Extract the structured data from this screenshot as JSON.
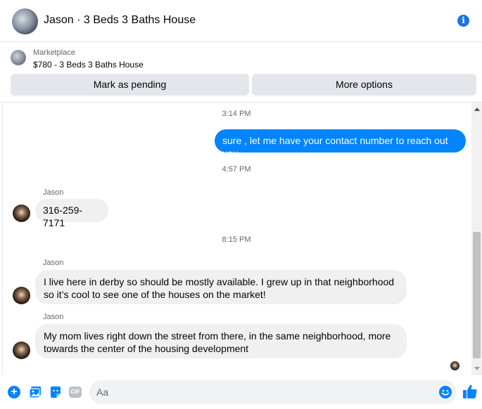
{
  "header": {
    "title": "Jason · 3 Beds 3 Baths House",
    "info_icon": "info-icon"
  },
  "marketplace": {
    "label": "Marketplace",
    "item": "$780 - 3 Beds 3 Baths House",
    "mark_pending_label": "Mark as pending",
    "more_options_label": "More options"
  },
  "messages": {
    "timestamps": [
      "3:14 PM",
      "4:57 PM",
      "8:15 PM"
    ],
    "outgoing_1": "sure , let me have your contact number to reach out you",
    "sender_name": "Jason",
    "incoming_1": "316-259-7171",
    "incoming_2": "I live here in derby so should be mostly available. I grew up in that neighborhood so it’s cool to see one of the houses on the market!",
    "incoming_3": "My mom lives right down the street from there, in the same neighborhood, more towards the center of the housing development"
  },
  "composer": {
    "placeholder": "Aa",
    "gif_label": "GIF"
  },
  "colors": {
    "accent": "#0084ff",
    "bubble_in": "#f0f0f0",
    "button_bg": "#e4e6eb"
  }
}
